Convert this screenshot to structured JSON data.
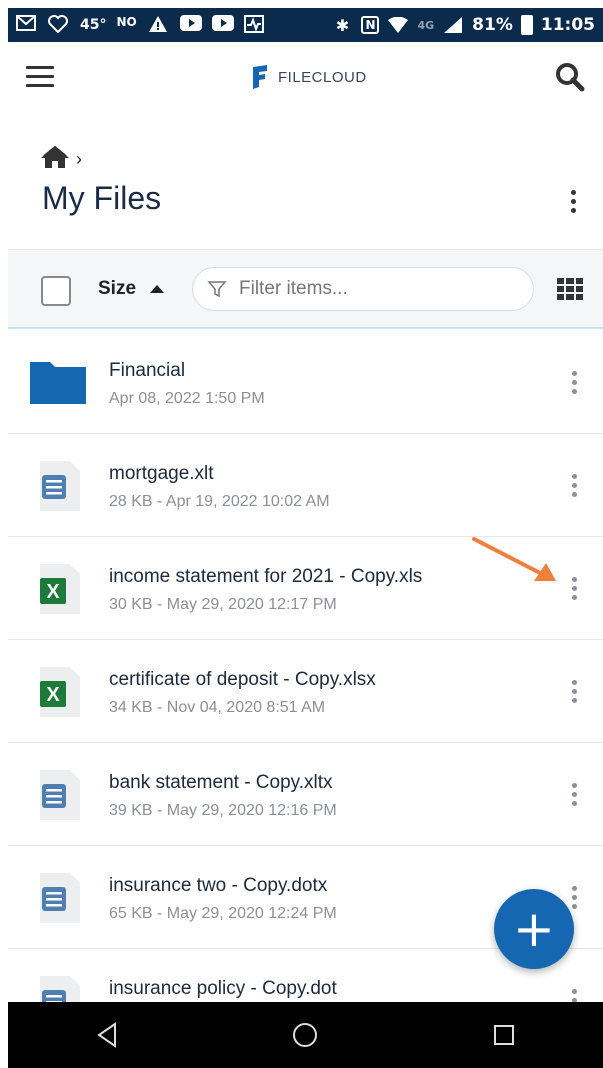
{
  "status_bar": {
    "left_icons": [
      "gmail-icon",
      "heart-icon",
      "temp-text",
      "nfc-icon",
      "warning-icon",
      "youtube-icon",
      "youtube-icon",
      "activity-icon"
    ],
    "temp": "45°",
    "network": "4G",
    "battery": "81%",
    "time": "11:05"
  },
  "app": {
    "logo_text": "FILECLOUD"
  },
  "breadcrumb": {
    "separator": "›"
  },
  "page_title": "My Files",
  "toolbar": {
    "sort_label": "Size",
    "filter_placeholder": "Filter items..."
  },
  "files": [
    {
      "name": "Financial",
      "meta": "Apr 08, 2022 1:50 PM",
      "type": "folder"
    },
    {
      "name": "mortgage.xlt",
      "meta": "28 KB - Apr 19, 2022 10:02 AM",
      "type": "doc"
    },
    {
      "name": "income statement for 2021 - Copy.xls",
      "meta": "30 KB - May 29, 2020 12:17 PM",
      "type": "excel"
    },
    {
      "name": "certificate of deposit - Copy.xlsx",
      "meta": "34 KB - Nov 04, 2020 8:51 AM",
      "type": "excel"
    },
    {
      "name": "bank statement - Copy.xltx",
      "meta": "39 KB - May 29, 2020 12:16 PM",
      "type": "doc"
    },
    {
      "name": "insurance two - Copy.dotx",
      "meta": "65 KB - May 29, 2020 12:24 PM",
      "type": "doc"
    },
    {
      "name": "insurance policy - Copy.dot",
      "meta": "",
      "type": "doc"
    }
  ],
  "fab_label": "+",
  "colors": {
    "status_bar": "#0b2b4c",
    "brand_blue": "#1467b0",
    "excel_green": "#1d7a3a",
    "arrow_orange": "#f07f3c"
  }
}
